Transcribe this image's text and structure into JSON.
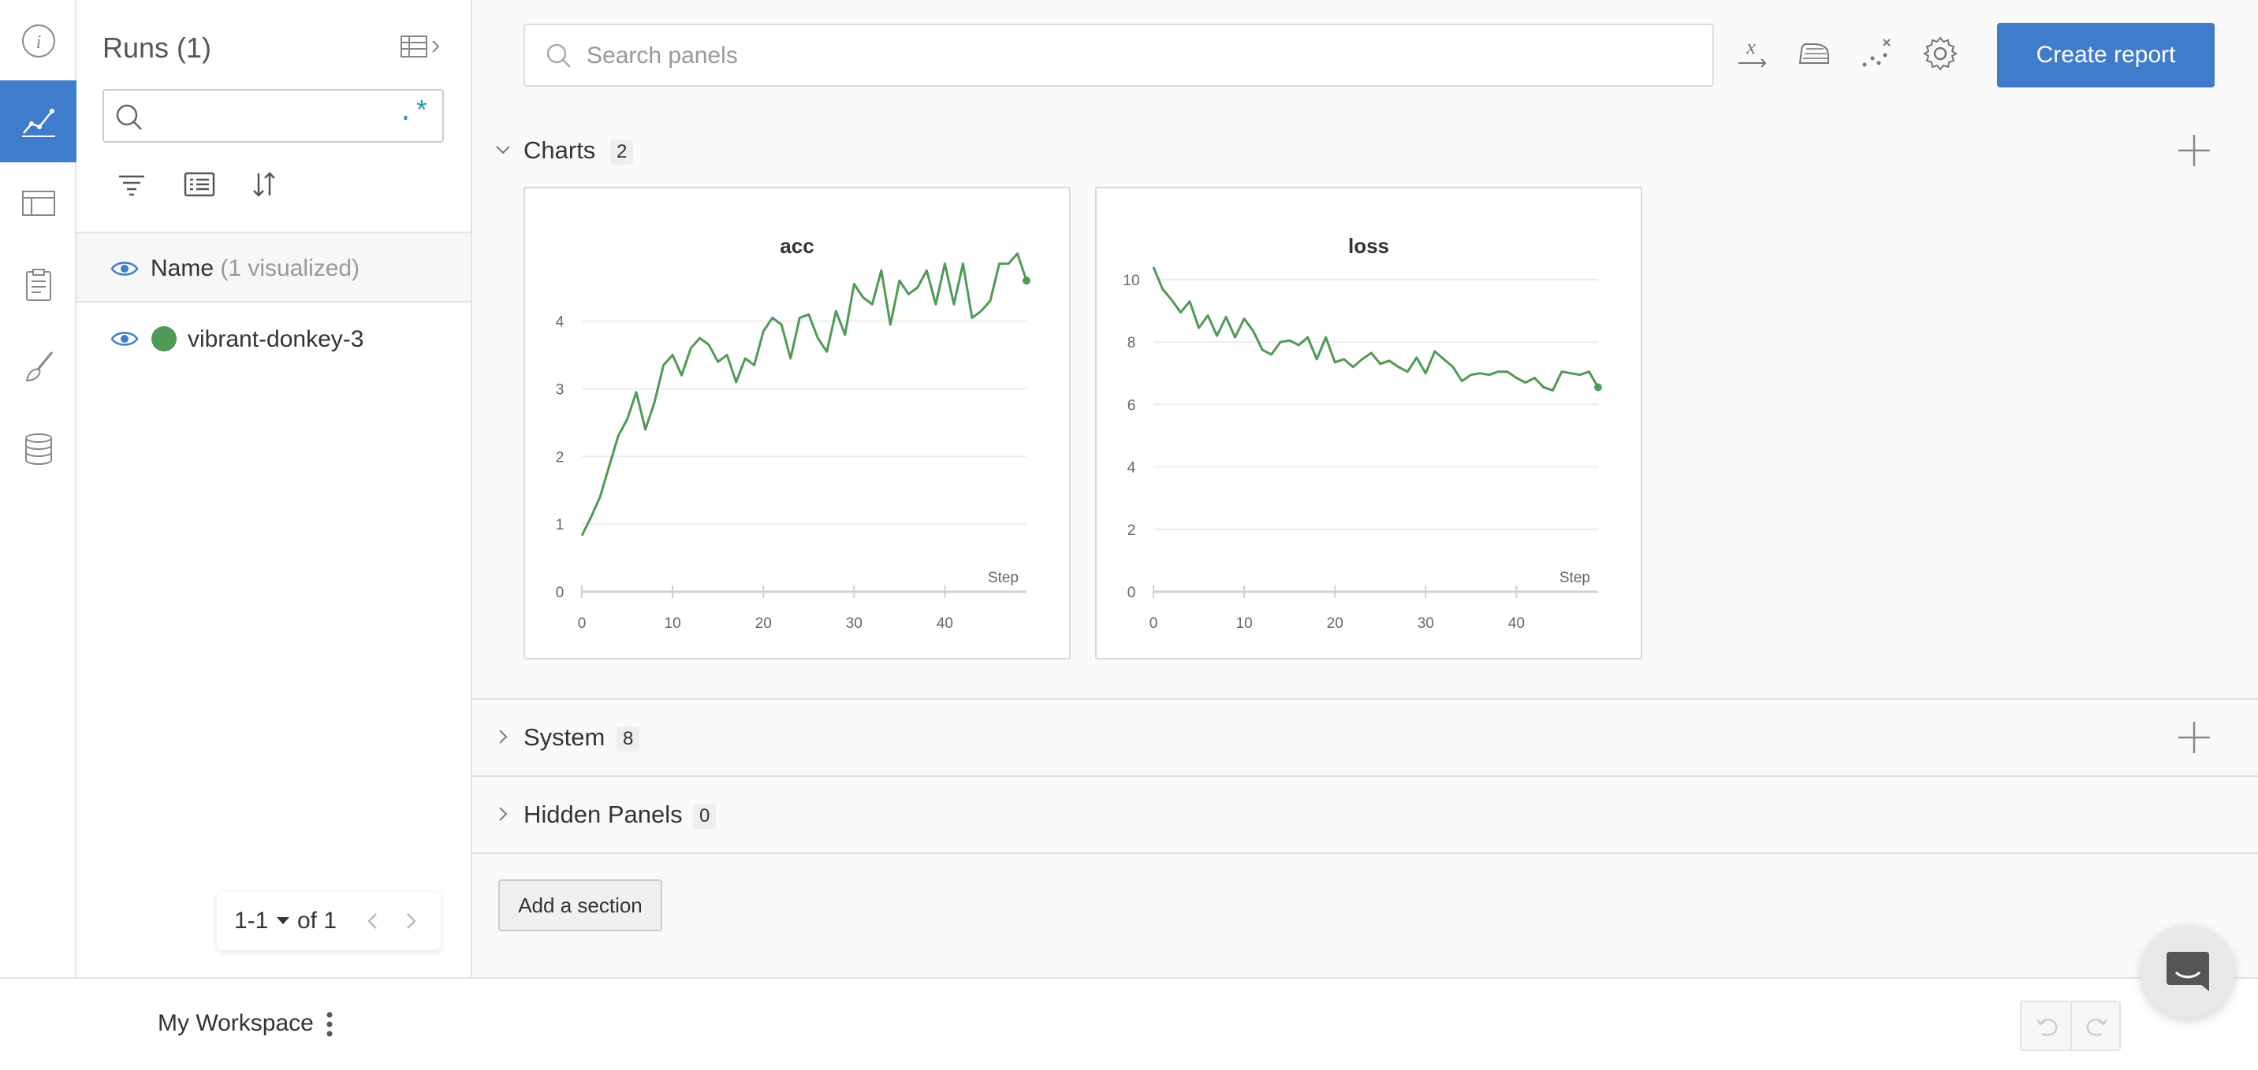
{
  "runs_panel": {
    "title": "Runs (1)",
    "search_value": "",
    "regex_symbol": ".*",
    "header_label": "Name",
    "header_sub": "(1 visualized)",
    "runs": [
      {
        "name": "vibrant-donkey-3",
        "color": "#4f9a55"
      }
    ],
    "pager": {
      "range": "1-1",
      "of": "of 1"
    }
  },
  "rail": {
    "items": [
      "info-icon",
      "charts-icon",
      "table-icon",
      "clipboard-icon",
      "sweep-brush-icon",
      "database-icon"
    ],
    "active": "charts-icon",
    "accent": "#3f7ccb"
  },
  "toolbar": {
    "search_placeholder": "Search panels",
    "icons": [
      "x-axis-icon",
      "smoothing-iron-icon",
      "outliers-icon",
      "settings-gear-icon"
    ],
    "create_report_label": "Create report"
  },
  "sections": [
    {
      "title": "Charts",
      "count": "2",
      "expanded": true
    },
    {
      "title": "System",
      "count": "8",
      "expanded": false
    },
    {
      "title": "Hidden Panels",
      "count": "0",
      "expanded": false
    }
  ],
  "add_section_label": "Add a section",
  "workspace": {
    "name": "My Workspace"
  },
  "chart_data": [
    {
      "type": "line",
      "title": "acc",
      "xlabel": "Step",
      "ylabel": "",
      "xlim": [
        0,
        49
      ],
      "ylim": [
        0,
        4.8
      ],
      "xticks": [
        0,
        10,
        20,
        30,
        40
      ],
      "yticks": [
        0,
        1,
        2,
        3,
        4
      ],
      "grid": true,
      "series": [
        {
          "color": "#4f9a55",
          "x": [
            0,
            1,
            2,
            3,
            4,
            5,
            6,
            7,
            8,
            9,
            10,
            11,
            12,
            13,
            14,
            15,
            16,
            17,
            18,
            19,
            20,
            21,
            22,
            23,
            24,
            25,
            26,
            27,
            28,
            29,
            30,
            31,
            32,
            33,
            34,
            35,
            36,
            37,
            38,
            39,
            40,
            41,
            42,
            43,
            44,
            45,
            46,
            47,
            48,
            49
          ],
          "y": [
            0.83,
            1.1,
            1.4,
            1.85,
            2.3,
            2.55,
            2.95,
            2.4,
            2.8,
            3.35,
            3.5,
            3.2,
            3.6,
            3.75,
            3.65,
            3.4,
            3.5,
            3.1,
            3.45,
            3.35,
            3.85,
            4.05,
            3.95,
            3.45,
            4.05,
            4.1,
            3.75,
            3.55,
            4.15,
            3.8,
            4.55,
            4.35,
            4.25,
            4.75,
            3.95,
            4.6,
            4.4,
            4.5,
            4.75,
            4.25,
            4.85,
            4.25,
            4.85,
            4.05,
            4.15,
            4.3,
            4.85,
            4.85,
            5.0,
            4.6
          ]
        }
      ]
    },
    {
      "type": "line",
      "title": "loss",
      "xlabel": "Step",
      "ylabel": "",
      "xlim": [
        0,
        49
      ],
      "ylim": [
        0,
        10.4
      ],
      "xticks": [
        0,
        10,
        20,
        30,
        40
      ],
      "yticks": [
        0,
        2,
        4,
        6,
        8,
        10
      ],
      "grid": true,
      "series": [
        {
          "color": "#4f9a55",
          "x": [
            0,
            1,
            2,
            3,
            4,
            5,
            6,
            7,
            8,
            9,
            10,
            11,
            12,
            13,
            14,
            15,
            16,
            17,
            18,
            19,
            20,
            21,
            22,
            23,
            24,
            25,
            26,
            27,
            28,
            29,
            30,
            31,
            32,
            33,
            34,
            35,
            36,
            37,
            38,
            39,
            40,
            41,
            42,
            43,
            44,
            45,
            46,
            47,
            48,
            49
          ],
          "y": [
            10.4,
            9.7,
            9.35,
            8.95,
            9.3,
            8.45,
            8.85,
            8.2,
            8.8,
            8.15,
            8.75,
            8.35,
            7.75,
            7.6,
            8.0,
            8.05,
            7.9,
            8.15,
            7.45,
            8.15,
            7.35,
            7.45,
            7.2,
            7.45,
            7.65,
            7.3,
            7.4,
            7.2,
            7.05,
            7.5,
            7.0,
            7.7,
            7.45,
            7.2,
            6.75,
            6.95,
            7.0,
            6.95,
            7.05,
            7.05,
            6.85,
            6.7,
            6.85,
            6.55,
            6.45,
            7.05,
            7.0,
            6.95,
            7.05,
            6.55
          ]
        }
      ]
    }
  ]
}
